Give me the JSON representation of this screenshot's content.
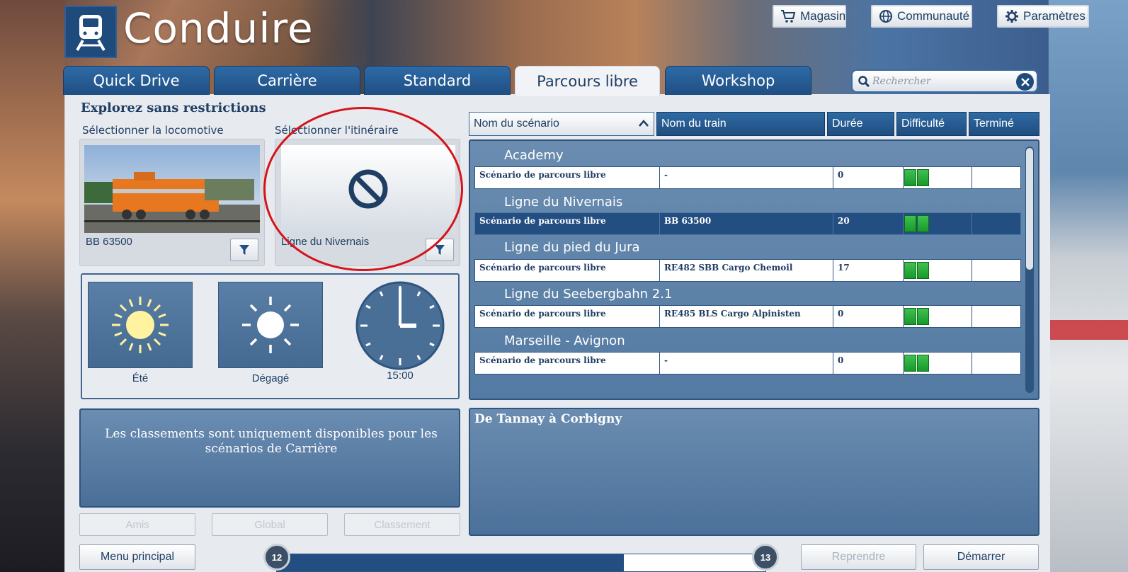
{
  "app": {
    "title": "Conduire"
  },
  "top_buttons": {
    "store": "Magasin",
    "community": "Communauté",
    "settings": "Paramètres"
  },
  "tabs": [
    {
      "label": "Quick Drive"
    },
    {
      "label": "Carrière"
    },
    {
      "label": "Standard"
    },
    {
      "label": "Parcours libre"
    },
    {
      "label": "Workshop"
    }
  ],
  "search": {
    "placeholder": "Rechercher"
  },
  "left": {
    "heading": "Explorez sans restrictions",
    "loco_label": "Sélectionner la locomotive",
    "route_label": "Sélectionner l'itinéraire",
    "loco_name": "BB 63500",
    "route_name": "Ligne du Nivernais"
  },
  "conditions": {
    "season": "Été",
    "weather": "Dégagé",
    "time": "15:00"
  },
  "leaderboard": {
    "message": "Les classements sont uniquement disponibles pour les scénarios de Carrière",
    "friends": "Amis",
    "global": "Global",
    "ranking": "Classement"
  },
  "table": {
    "headers": {
      "scenario": "Nom du scénario",
      "train": "Nom du train",
      "duration": "Durée",
      "difficulty": "Difficulté",
      "done": "Terminé"
    },
    "groups": [
      {
        "title": "Academy",
        "scenario": "Scénario de parcours libre",
        "train": "-",
        "duration": "0",
        "difficulty": 2
      },
      {
        "title": "Ligne du Nivernais",
        "scenario": "Scénario de parcours libre",
        "train": "BB 63500",
        "duration": "20",
        "difficulty": 2
      },
      {
        "title": "Ligne du pied du Jura",
        "scenario": "Scénario de parcours libre",
        "train": "RE482 SBB Cargo Chemoil",
        "duration": "17",
        "difficulty": 2
      },
      {
        "title": "Ligne du Seebergbahn 2.1",
        "scenario": "Scénario de parcours libre",
        "train": "RE485 BLS Cargo Alpinisten",
        "duration": "0",
        "difficulty": 2
      },
      {
        "title": "Marseille - Avignon",
        "scenario": "Scénario de parcours libre",
        "train": "-",
        "duration": "0",
        "difficulty": 2
      }
    ]
  },
  "description": {
    "title": "De Tannay à Corbigny"
  },
  "bottom": {
    "main_menu": "Menu principal",
    "resume": "Reprendre",
    "start": "Démarrer",
    "level_current": "12",
    "level_next": "13",
    "progress": 0.71
  },
  "colors": {
    "accent": "#1f4f83",
    "panel": "#547ba3",
    "annotation": "#d4141a",
    "difficulty": "#2fb040"
  }
}
